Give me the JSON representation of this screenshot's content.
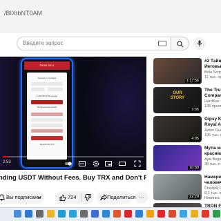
{
  "browser": {
    "url": "/BIXtbNT0AM"
  },
  "search": {
    "placeholder": "Введите запрос"
  },
  "player": {
    "time": "2:53"
  },
  "video": {
    "title": "nding USDT Without Fees. Buy TRX and Don't Pay For",
    "subscribe_label": "Вы подписаны",
    "likes": "724",
    "share_label": "Поделиться",
    "more": "..."
  },
  "phone_screen": {
    "header": "TRON SELL",
    "line1": "Amount in contracts",
    "line2": "1,203.351 TRX energy",
    "line3": "81 Прошлый сессий",
    "line4": "Total 50.00 TRX"
  },
  "recommendations": [
    {
      "title_1": "#2 Тайн",
      "title_2": "Иеговы",
      "channel": "Bola Script",
      "meta": "11 тыс. пр",
      "duration": "1:17:56",
      "colors": [
        "#6b4a3a",
        "#2b2a2a"
      ]
    },
    {
      "title_1": "The Truth",
      "title_2": "Compani",
      "channel": "HardKas",
      "meta": "135 просм",
      "duration": "3:05",
      "badge": "OUR STORY",
      "colors": [
        "#2a2a2a",
        "#111"
      ]
    },
    {
      "title_1": "Gipsy Kin",
      "title_2": "Royal Alb",
      "channel": "Aston Gue",
      "meta": "196 тыс. п",
      "duration": "4:05",
      "colors": [
        "#3a3530",
        "#1b1814"
      ]
    },
    {
      "title_1": "Мула ма",
      "title_2": "красива",
      "channel": "Aум Веда",
      "meta": "38 тыс. п",
      "duration": "10:39",
      "colors": [
        "#2d2a8a",
        "#7a38c0"
      ]
    },
    {
      "title_1": "Намерен",
      "title_2": "человеч",
      "channel": "Chestok C",
      "meta": "8,2 тыс. п",
      "meta2": "Новинка",
      "duration": "12:29",
      "colors": [
        "#9aa3a6",
        "#5a6062"
      ]
    },
    {
      "title_1": "TRON Fin",
      "title_2": "",
      "channel": "",
      "meta": "",
      "duration": "",
      "colors": [
        "#3a3a3a",
        "#555"
      ]
    }
  ]
}
